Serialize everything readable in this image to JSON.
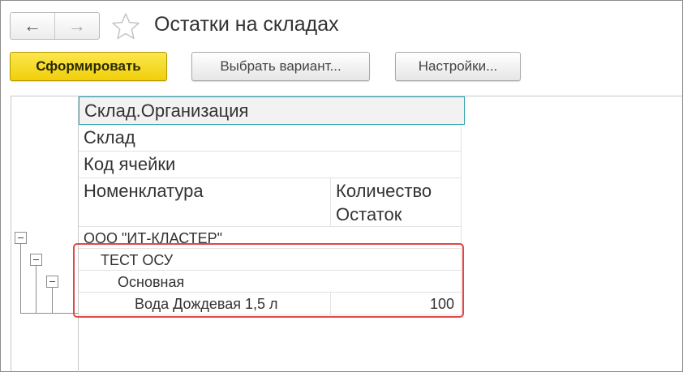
{
  "header": {
    "title": "Остатки на складах",
    "back_icon": "←",
    "forward_icon": "→"
  },
  "toolbar": {
    "generate_label": "Сформировать",
    "variant_label": "Выбрать вариант...",
    "settings_label": "Настройки..."
  },
  "report": {
    "headers": {
      "group1": "Склад.Организация",
      "group2": "Склад",
      "group3": "Код ячейки",
      "item": "Номенклатура",
      "qty_line1": "Количество",
      "qty_line2": "Остаток"
    },
    "rows": [
      {
        "level": 0,
        "name": "ООО \"ИТ-КЛАСТЕР\"",
        "value": ""
      },
      {
        "level": 1,
        "name": "ТЕСТ ОСУ",
        "value": ""
      },
      {
        "level": 2,
        "name": "Основная",
        "value": ""
      },
      {
        "level": 3,
        "name": "Вода Дождевая 1,5 л",
        "value": "100"
      }
    ]
  },
  "colors": {
    "primary_button": "#f2cf0b",
    "highlight_border": "#e04747",
    "active_header_border": "#2fa3b0"
  }
}
